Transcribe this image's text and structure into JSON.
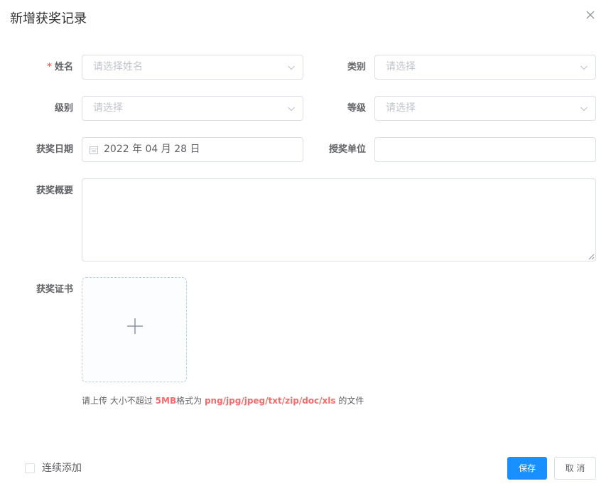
{
  "dialog": {
    "title": "新增获奖记录"
  },
  "form": {
    "name": {
      "label": "姓名",
      "placeholder": "请选择姓名",
      "required": true
    },
    "category": {
      "label": "类别",
      "placeholder": "请选择"
    },
    "level": {
      "label": "级别",
      "placeholder": "请选择"
    },
    "grade": {
      "label": "等级",
      "placeholder": "请选择"
    },
    "award_date": {
      "label": "获奖日期",
      "value": "2022 年 04 月 28 日"
    },
    "award_unit": {
      "label": "授奖单位",
      "value": ""
    },
    "summary": {
      "label": "获奖概要",
      "value": ""
    },
    "certificate": {
      "label": "获奖证书"
    }
  },
  "upload_tip": {
    "prefix": "请上传 大小不超过",
    "size": "5MB",
    "middle": "格式为",
    "formats": "png/jpg/jpeg/txt/zip/doc/xls",
    "suffix": "的文件"
  },
  "footer": {
    "continue_add": "连续添加",
    "save": "保存",
    "cancel": "取 消"
  },
  "colors": {
    "primary": "#1890ff",
    "required": "#f56c6c",
    "border": "#dcdfe6",
    "placeholder": "#c0c4cc"
  }
}
